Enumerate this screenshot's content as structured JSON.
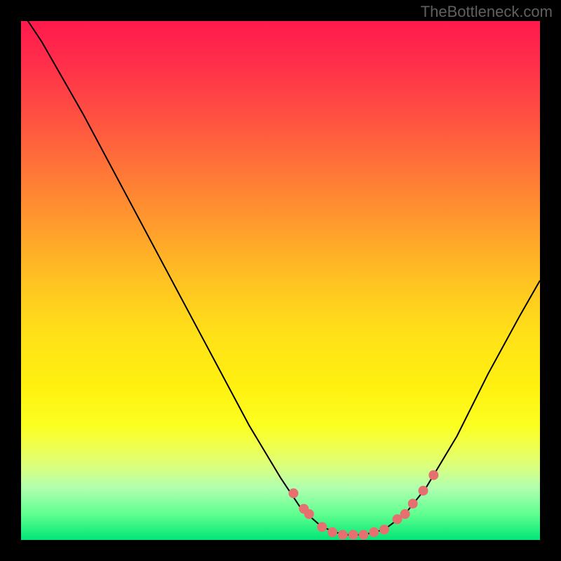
{
  "attribution": "TheBottleneck.com",
  "chart_data": {
    "type": "line",
    "title": "",
    "xlabel": "",
    "ylabel": "",
    "xlim": [
      0,
      100
    ],
    "ylim": [
      0,
      100
    ],
    "curve": [
      {
        "x": 0,
        "y": 102
      },
      {
        "x": 4,
        "y": 96
      },
      {
        "x": 12,
        "y": 82
      },
      {
        "x": 20,
        "y": 67
      },
      {
        "x": 28,
        "y": 52
      },
      {
        "x": 36,
        "y": 37
      },
      {
        "x": 44,
        "y": 22
      },
      {
        "x": 50,
        "y": 12
      },
      {
        "x": 54,
        "y": 6
      },
      {
        "x": 58,
        "y": 2.5
      },
      {
        "x": 62,
        "y": 1
      },
      {
        "x": 66,
        "y": 1
      },
      {
        "x": 70,
        "y": 2
      },
      {
        "x": 74,
        "y": 5
      },
      {
        "x": 78,
        "y": 10
      },
      {
        "x": 84,
        "y": 20
      },
      {
        "x": 90,
        "y": 32
      },
      {
        "x": 96,
        "y": 43
      },
      {
        "x": 100,
        "y": 50
      }
    ],
    "markers": [
      {
        "x": 52.5,
        "y": 9
      },
      {
        "x": 54.5,
        "y": 6
      },
      {
        "x": 55.5,
        "y": 5
      },
      {
        "x": 58,
        "y": 2.5
      },
      {
        "x": 60,
        "y": 1.5
      },
      {
        "x": 62,
        "y": 1
      },
      {
        "x": 64,
        "y": 1
      },
      {
        "x": 66,
        "y": 1
      },
      {
        "x": 68,
        "y": 1.5
      },
      {
        "x": 70,
        "y": 2
      },
      {
        "x": 72.5,
        "y": 4
      },
      {
        "x": 74,
        "y": 5
      },
      {
        "x": 75.5,
        "y": 7
      },
      {
        "x": 77.5,
        "y": 9.5
      },
      {
        "x": 79.5,
        "y": 12.5
      }
    ],
    "marker_color": "#e6706f",
    "line_color": "#000000"
  }
}
